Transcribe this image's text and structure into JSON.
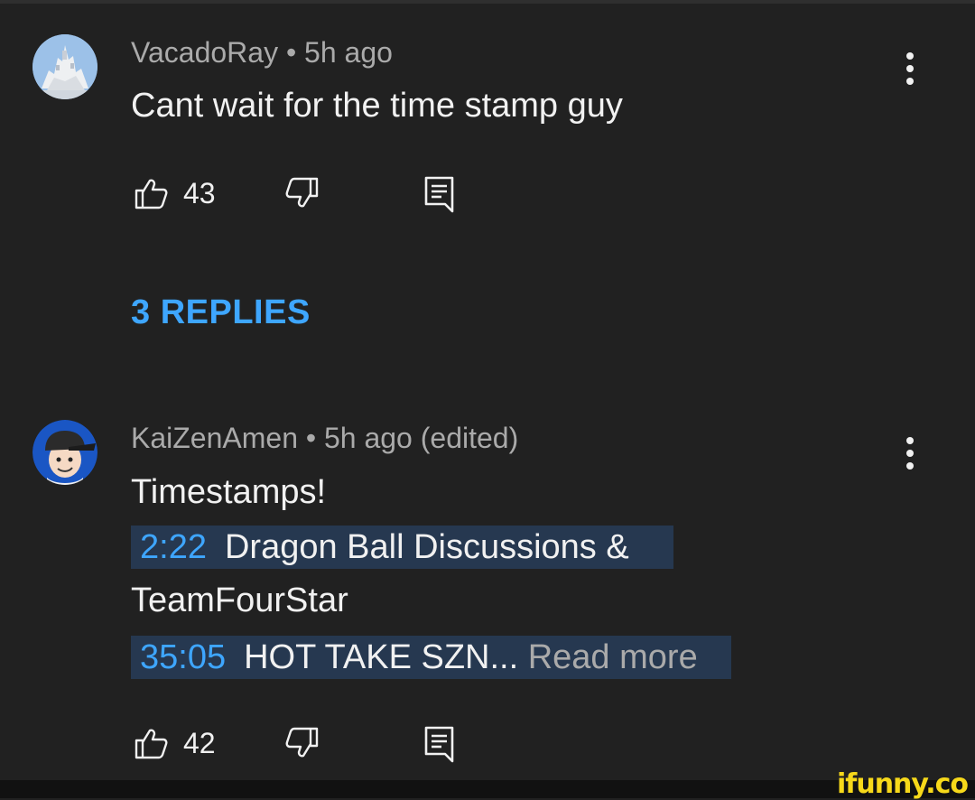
{
  "comments": [
    {
      "author": "VacadoRay",
      "age": "5h ago",
      "edited": "",
      "text": "Cant wait for the time stamp guy",
      "likes": "43",
      "replies_label": "3 REPLIES",
      "avatar": "castle-avatar"
    },
    {
      "author": "KaiZenAmen",
      "age": "5h ago",
      "edited": "(edited)",
      "text": "Timestamps!",
      "timestamps": [
        {
          "time": "2:22",
          "label": "Dragon Ball Discussions &"
        },
        {
          "time": "35:05",
          "label": "HOT TAKE SZN..."
        }
      ],
      "continuation": "TeamFourStar",
      "read_more": "Read more",
      "likes": "42",
      "avatar": "cartoon-cap-avatar"
    }
  ],
  "separator": " • ",
  "icons": {
    "like": "thumbs-up-icon",
    "dislike": "thumbs-down-icon",
    "reply": "reply-comment-icon",
    "more": "more-vertical-icon"
  },
  "colors": {
    "background": "#212121",
    "link": "#3ea6ff",
    "timestamp_highlight": "#263850",
    "watermark": "#f6d81a"
  },
  "watermark": "ifunny.co"
}
